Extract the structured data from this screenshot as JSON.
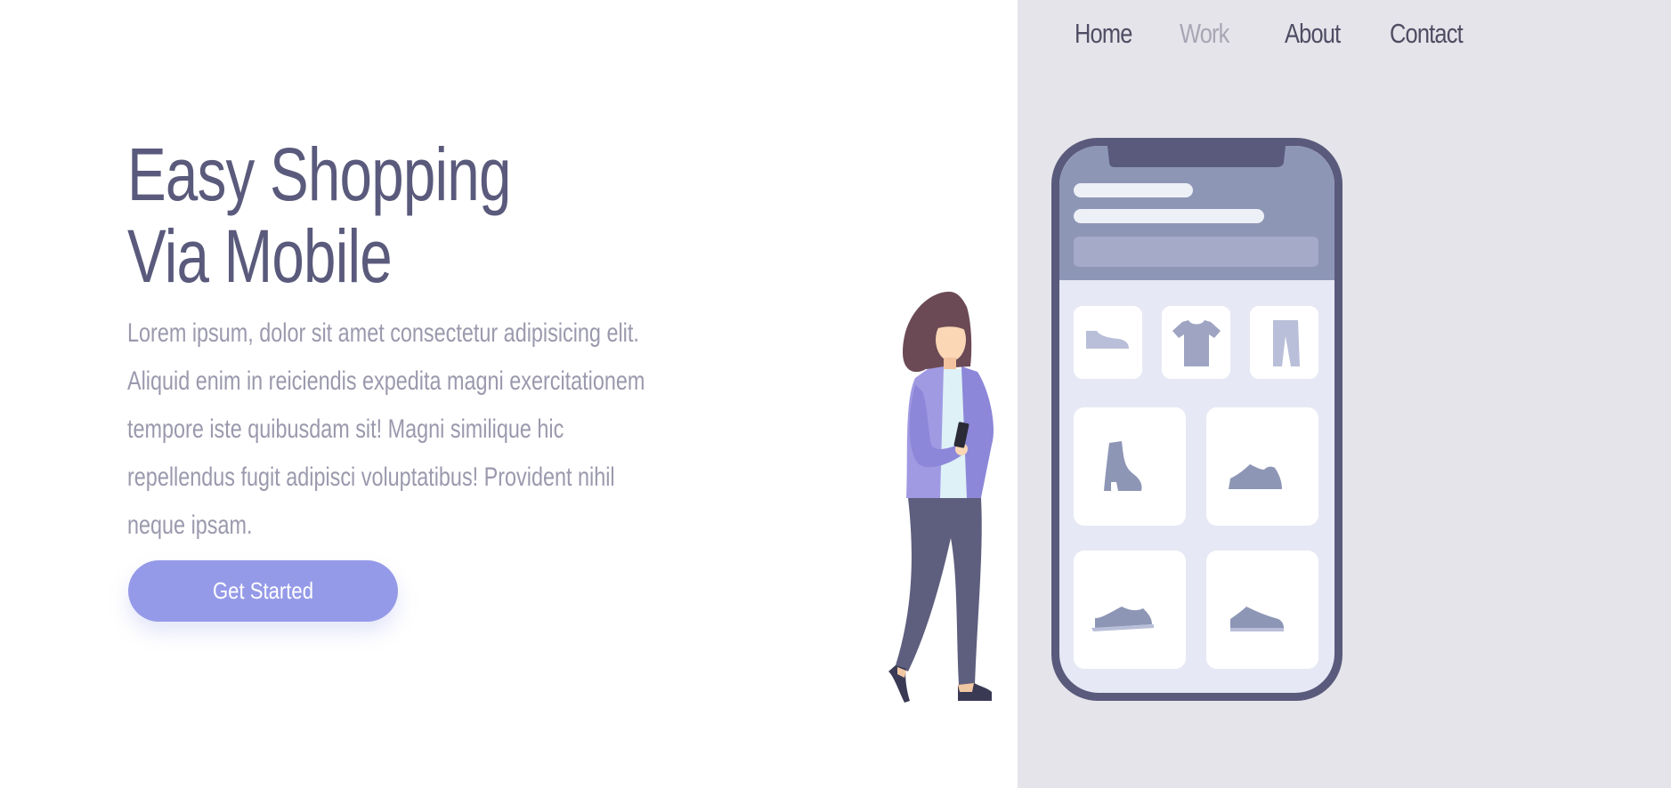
{
  "nav": {
    "items": [
      {
        "label": "Home"
      },
      {
        "label": "Work"
      },
      {
        "label": "About"
      },
      {
        "label": "Contact"
      }
    ],
    "active": "Work"
  },
  "hero": {
    "title_line1": "Easy Shopping",
    "title_line2": "Via Mobile",
    "description": "Lorem ipsum, dolor sit amet consectetur adipisicing elit. Aliquid enim in reiciendis expedita magni exercitationem tempore iste quibusdam sit! Magni similique hic repellendus fugit adipisci voluptatibus! Provident nihil neque ipsam.",
    "cta_label": "Get Started"
  },
  "illustration": {
    "icons": [
      "shoe-icon",
      "tshirt-icon",
      "pants-icon",
      "boot-icon",
      "sneaker-icon",
      "sneaker-icon",
      "sneaker-icon"
    ]
  },
  "colors": {
    "accent": "#959ae8",
    "heading": "#5a5a7c",
    "body_text": "#9a99ad",
    "nav_text": "#4e4d63",
    "nav_active": "#a7a6b4",
    "panel_bg": "#e5e4ea",
    "phone_frame": "#5a5a7c"
  }
}
